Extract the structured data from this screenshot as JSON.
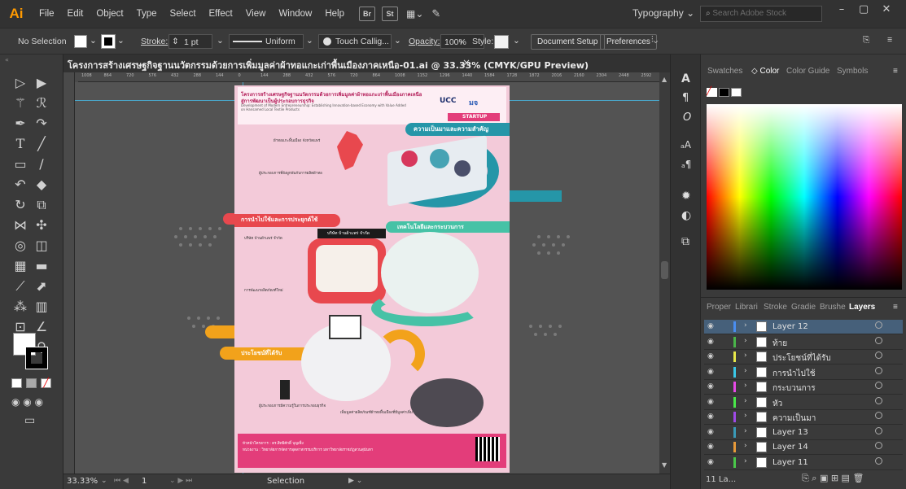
{
  "app": {
    "logo": "Ai"
  },
  "menu": [
    "File",
    "Edit",
    "Object",
    "Type",
    "Select",
    "Effect",
    "View",
    "Window",
    "Help"
  ],
  "menu_icons": {
    "bridge": "Br",
    "stock": "St"
  },
  "workspace": {
    "label": "Typography",
    "chevron": "⌄"
  },
  "search": {
    "placeholder": "Search Adobe Stock"
  },
  "control": {
    "selection": "No Selection",
    "stroke_label": "Stroke:",
    "stroke_value": "1 pt",
    "uniform": "Uniform",
    "brush": "Touch Callig...",
    "opacity_label": "Opacity:",
    "opacity_value": "100%",
    "style_label": "Style:",
    "doc_setup": "Document Setup",
    "preferences": "Preferences"
  },
  "document": {
    "tab_title": "โครงการสร้างเศรษฐกิจฐานนวัตกรรมด้วยการเพิ่มมูลค่าผ้าทอแกะเก่าพื้นเมืองภาคเหนือ-01.ai @ 33.33% (CMYK/GPU Preview)",
    "close": "×"
  },
  "ruler_ticks": [
    "1008",
    "864",
    "720",
    "576",
    "432",
    "288",
    "144",
    "0",
    "144",
    "288",
    "432",
    "576",
    "720",
    "864",
    "1008",
    "1152",
    "1296",
    "1440",
    "1584",
    "1728",
    "1872",
    "2016",
    "2160",
    "2304",
    "2448",
    "2592"
  ],
  "status": {
    "zoom": "33.33%",
    "artboard": "1",
    "mode": "Selection"
  },
  "poster": {
    "header_line1": "โครงการสร้างเศรษฐกิจฐานนวัตกรรมด้วยการเพิ่มมูลค่าผ้าทอแกะเก่าพื้นเมืองภาคเหนือ",
    "header_line2": "สู่การพัฒนาเป็นผู้ประกอบการธุรกิจ",
    "header_en1": "Development of Modern Entrepreneurship: Establishing Innovation-based Economy with Value Added",
    "header_en2": "on Hansamed Local Textile Products",
    "startup": "STARTUP",
    "brand1": "UCC",
    "brand2": "มจ",
    "sec1": "ความเป็นมาและความสำคัญ",
    "sec2": "การนำไปใช้และการประยุกต์ใช้",
    "sec3": "เทคโนโลยีและกระบวนการ",
    "sec4": "ประโยชน์ที่ได้รับ",
    "note1": "ผ้าทอแกะพื้นเมือง จังหวัดแพร่",
    "note2": "ผู้ประกอบการที่ยังผูกพันกับการผลิตผ้าทอ",
    "shop_sign": "บริษัท บ้านผ้าแพร่ จำกัด",
    "note3": "บริษัท บ้านผ้าแพร่ จำกัด",
    "note4": "การพัฒนาผลิตภัณฑ์ใหม่",
    "note5": "ผู้ประกอบการมีความรู้ในการประกอบธุรกิจ",
    "note6": "เพิ่มมูลค่าผลิตภัณฑ์ผ้าทอพื้นเมืองที่มีมูลค่าเพิ่ม",
    "footer1": "หัวหน้าโครงการ : ดร.สิทธิศักดิ์ บุญเซ็ง",
    "footer2": "หน่วยงาน : วิทยาลัยการจัดการอุตสาหกรรมบริการ มหาวิทยาลัยราชภัฏสวนสุนันทา"
  },
  "right_panel": {
    "tabs": [
      "Swatches",
      "Color",
      "Color Guide",
      "Symbols"
    ],
    "layer_tabs": [
      "Proper",
      "Librari",
      "Stroke",
      "Gradie",
      "Brushe",
      "Layers"
    ],
    "layers": [
      {
        "name": "Layer 12",
        "color": "#4a8ef0",
        "selected": true
      },
      {
        "name": "ท้าย",
        "color": "#4ab54a",
        "selected": false
      },
      {
        "name": "ประโยชน์ที่ได้รับ",
        "color": "#e8e84a",
        "selected": false
      },
      {
        "name": "การนำไปใช้",
        "color": "#3ac8e8",
        "selected": false
      },
      {
        "name": "กระบวนการ",
        "color": "#e84ae8",
        "selected": false
      },
      {
        "name": "หัว",
        "color": "#4ae84a",
        "selected": false
      },
      {
        "name": "ความเป็นมา",
        "color": "#a04ae8",
        "selected": false
      },
      {
        "name": "Layer 13",
        "color": "#3a9ab8",
        "selected": false
      },
      {
        "name": "Layer 14",
        "color": "#e89a3a",
        "selected": false
      },
      {
        "name": "Layer 11",
        "color": "#4ac84a",
        "selected": false
      }
    ],
    "layer_count": "11 La..."
  }
}
